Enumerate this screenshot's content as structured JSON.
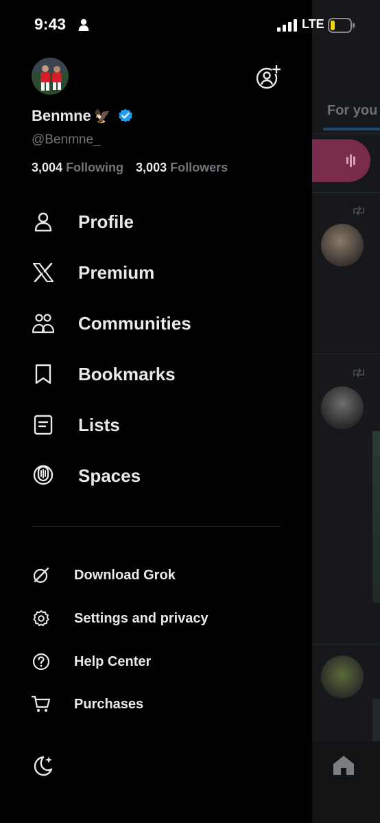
{
  "status_bar": {
    "time": "9:43",
    "network": "LTE"
  },
  "profile": {
    "display_name": "Benmne",
    "name_emoji": "🦅",
    "handle": "@Benmne_",
    "following_count": "3,004",
    "following_label": "Following",
    "followers_count": "3,003",
    "followers_label": "Followers"
  },
  "nav": {
    "items": [
      {
        "label": "Profile",
        "icon": "person-icon"
      },
      {
        "label": "Premium",
        "icon": "x-logo-icon"
      },
      {
        "label": "Communities",
        "icon": "communities-icon"
      },
      {
        "label": "Bookmarks",
        "icon": "bookmark-icon"
      },
      {
        "label": "Lists",
        "icon": "list-icon"
      },
      {
        "label": "Spaces",
        "icon": "spaces-icon"
      }
    ],
    "secondary": [
      {
        "label": "Download Grok",
        "icon": "grok-icon"
      },
      {
        "label": "Settings and privacy",
        "icon": "gear-icon"
      },
      {
        "label": "Help Center",
        "icon": "help-icon"
      },
      {
        "label": "Purchases",
        "icon": "cart-icon"
      }
    ]
  },
  "background_feed": {
    "tab_label": "For you"
  },
  "colors": {
    "background": "#000000",
    "text": "#e7e9ea",
    "muted": "#71767b",
    "verified": "#1d9bf0"
  }
}
